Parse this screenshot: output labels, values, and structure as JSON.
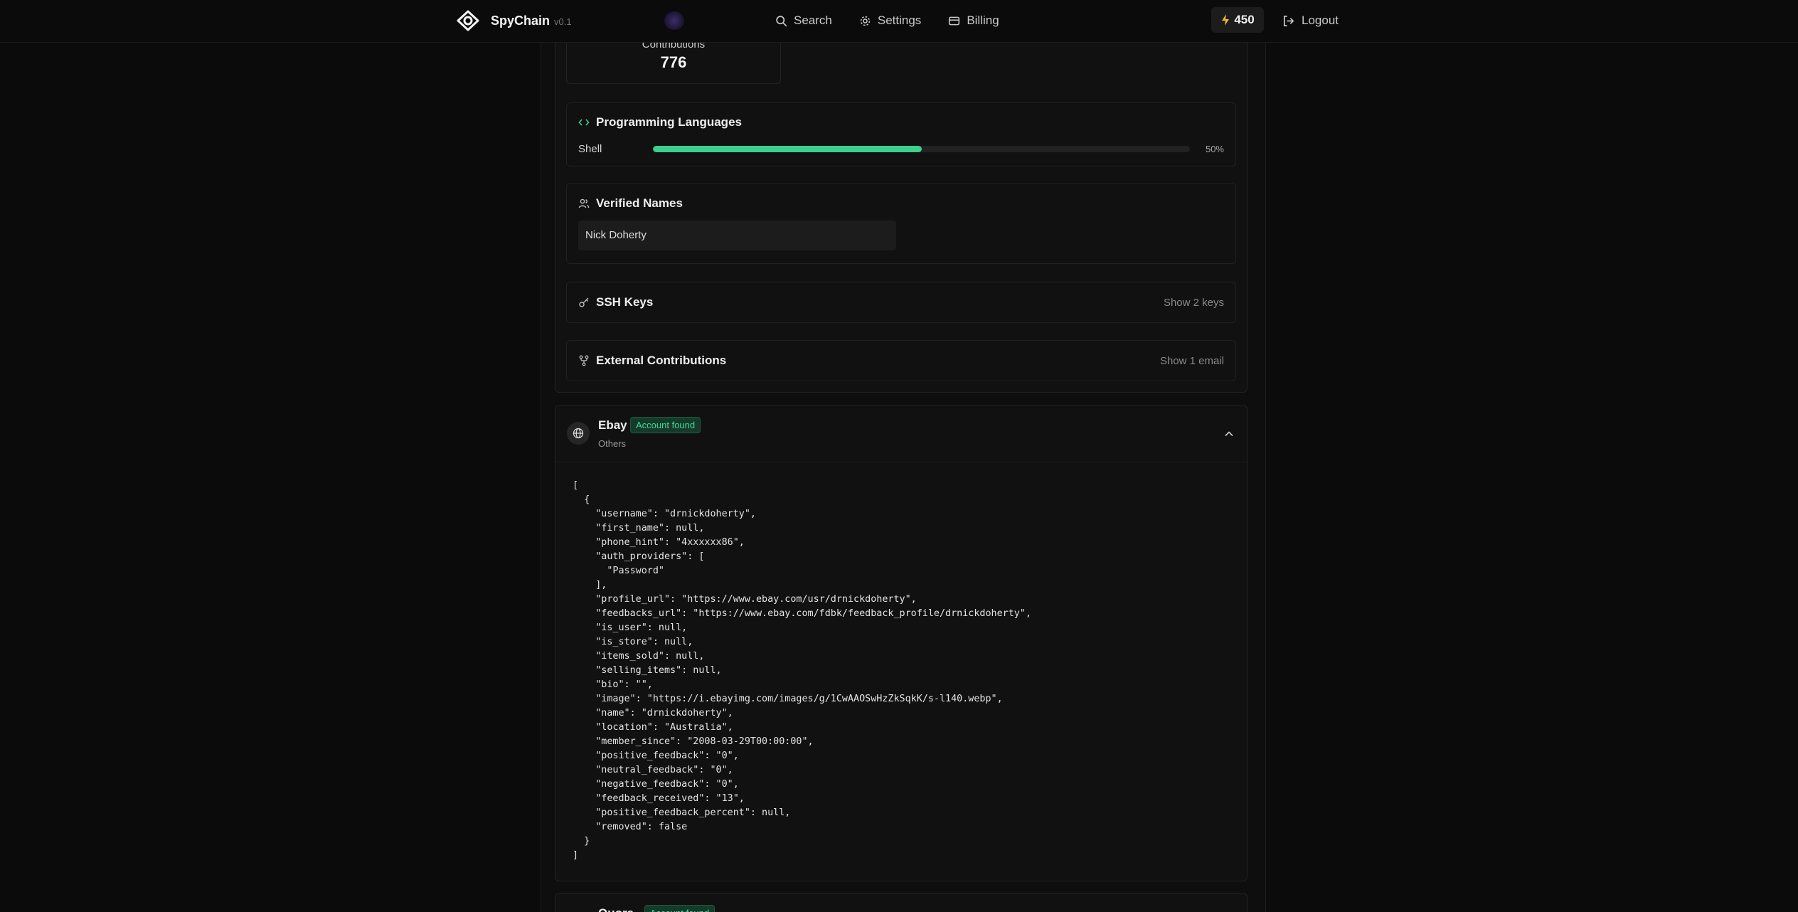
{
  "nav": {
    "brand": "SpyChain",
    "version": "v0.1",
    "links": [
      {
        "label": "Search",
        "icon": "search-icon"
      },
      {
        "label": "Settings",
        "icon": "gear-icon"
      },
      {
        "label": "Billing",
        "icon": "credit-card-icon"
      }
    ],
    "credits": "450",
    "logout": "Logout"
  },
  "stats": {
    "contributions_label": "Contributions",
    "contributions_value": "776"
  },
  "languages": {
    "title": "Programming Languages",
    "items": [
      {
        "name": "Shell",
        "percent": 50,
        "percent_label": "50%"
      }
    ]
  },
  "verified_names": {
    "title": "Verified Names",
    "names": [
      "Nick Doherty"
    ]
  },
  "ssh_keys": {
    "title": "SSH Keys",
    "action": "Show 2 keys"
  },
  "external": {
    "title": "External Contributions",
    "action": "Show 1 email"
  },
  "ebay": {
    "title": "Ebay",
    "badge": "Account found",
    "subtitle": "Others",
    "json_lines": [
      "[",
      "  {",
      "    \"username\": \"drnickdoherty\",",
      "    \"first_name\": null,",
      "    \"phone_hint\": \"4xxxxxx86\",",
      "    \"auth_providers\": [",
      "      \"Password\"",
      "    ],",
      "    \"profile_url\": \"https://www.ebay.com/usr/drnickdoherty\",",
      "    \"feedbacks_url\": \"https://www.ebay.com/fdbk/feedback_profile/drnickdoherty\",",
      "    \"is_user\": null,",
      "    \"is_store\": null,",
      "    \"items_sold\": null,",
      "    \"selling_items\": null,",
      "    \"bio\": \"\",",
      "    \"image\": \"https://i.ebayimg.com/images/g/1CwAAOSwHzZkSqkK/s-l140.webp\",",
      "    \"name\": \"drnickdoherty\",",
      "    \"location\": \"Australia\",",
      "    \"member_since\": \"2008-03-29T00:00:00\",",
      "    \"positive_feedback\": \"0\",",
      "    \"neutral_feedback\": \"0\",",
      "    \"negative_feedback\": \"0\",",
      "    \"feedback_received\": \"13\",",
      "    \"positive_feedback_percent\": null,",
      "    \"removed\": false",
      "  }",
      "]"
    ]
  },
  "next_card": {
    "title": "Quora",
    "badge": "Account found"
  },
  "colors": {
    "accent": "#3ecf8e",
    "badge_text": "#48d597",
    "credits_bolt": "#f5b82e",
    "link_icon": "#3ecf8e"
  }
}
